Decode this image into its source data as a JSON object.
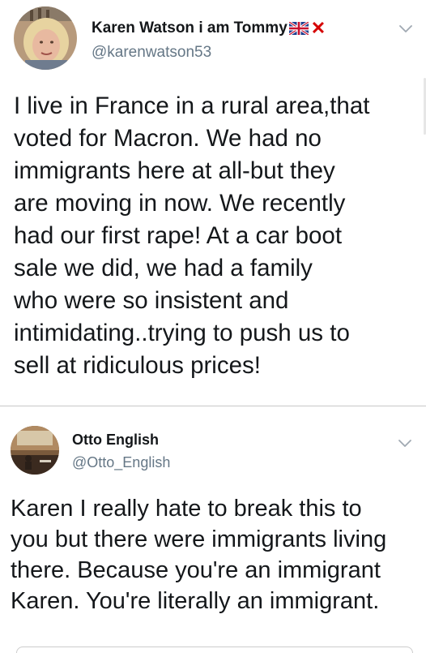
{
  "tweets": [
    {
      "author": {
        "name": "Karen Watson i am Tommy",
        "handle": "@karenwatson53",
        "name_emoji": [
          "uk-flag-icon",
          "red-x-icon"
        ],
        "red_x": "✕"
      },
      "text": "I live in France in a rural area,that\nvoted for Macron. We had no\nimmigrants here at all-but they\nare moving in now. We recently\nhad our first rape! At a car boot\nsale we did, we had a family\nwho were so insistent and\nintimidating..trying to push us to\nsell at ridiculous prices!"
    },
    {
      "author": {
        "name": "Otto English",
        "handle": "@Otto_English"
      },
      "text": "Karen I really hate to break this to\nyou but there were immigrants living\nthere. Because you're an immigrant\nKaren. You're literally an immigrant."
    }
  ],
  "colors": {
    "text": "#14171a",
    "secondary": "#657786",
    "divider": "#c8c8c8",
    "red_x": "#d50000"
  }
}
